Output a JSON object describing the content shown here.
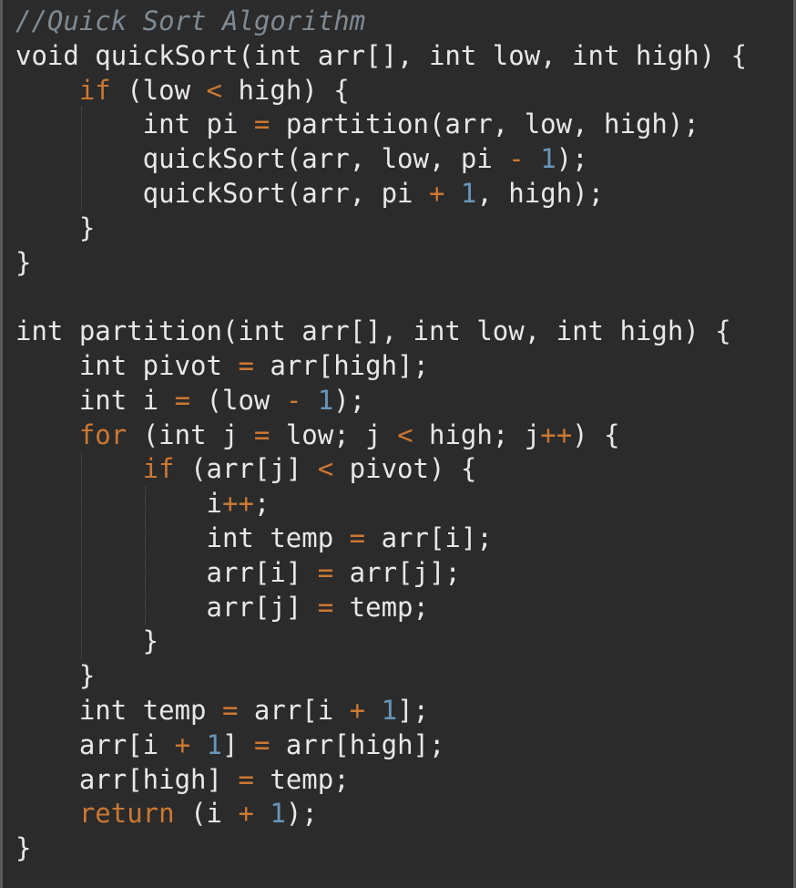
{
  "editor": {
    "language": "c",
    "theme": "dark",
    "colors": {
      "background": "#2b2b2b",
      "text": "#e8e8e8",
      "keyword": "#cc7832",
      "number": "#6897bb",
      "comment": "#7f8a93",
      "operator": "#cc7832"
    },
    "lines": [
      [
        {
          "t": "comment",
          "v": "//Quick Sort Algorithm"
        }
      ],
      [
        {
          "t": "plain",
          "v": "void quickSort(int arr[], int low, int high) {"
        }
      ],
      [
        {
          "t": "plain",
          "v": "    "
        },
        {
          "t": "keyword",
          "v": "if"
        },
        {
          "t": "plain",
          "v": " (low "
        },
        {
          "t": "op",
          "v": "<"
        },
        {
          "t": "plain",
          "v": " high) {"
        }
      ],
      [
        {
          "t": "plain",
          "v": "        int pi "
        },
        {
          "t": "op",
          "v": "="
        },
        {
          "t": "plain",
          "v": " partition(arr, low, high);"
        }
      ],
      [
        {
          "t": "plain",
          "v": "        quickSort(arr, low, pi "
        },
        {
          "t": "op",
          "v": "-"
        },
        {
          "t": "plain",
          "v": " "
        },
        {
          "t": "number",
          "v": "1"
        },
        {
          "t": "plain",
          "v": ");"
        }
      ],
      [
        {
          "t": "plain",
          "v": "        quickSort(arr, pi "
        },
        {
          "t": "op",
          "v": "+"
        },
        {
          "t": "plain",
          "v": " "
        },
        {
          "t": "number",
          "v": "1"
        },
        {
          "t": "plain",
          "v": ", high);"
        }
      ],
      [
        {
          "t": "plain",
          "v": "    }"
        }
      ],
      [
        {
          "t": "plain",
          "v": "}"
        }
      ],
      [
        {
          "t": "plain",
          "v": ""
        }
      ],
      [
        {
          "t": "plain",
          "v": "int partition(int arr[], int low, int high) {"
        }
      ],
      [
        {
          "t": "plain",
          "v": "    int pivot "
        },
        {
          "t": "op",
          "v": "="
        },
        {
          "t": "plain",
          "v": " arr[high];"
        }
      ],
      [
        {
          "t": "plain",
          "v": "    int i "
        },
        {
          "t": "op",
          "v": "="
        },
        {
          "t": "plain",
          "v": " (low "
        },
        {
          "t": "op",
          "v": "-"
        },
        {
          "t": "plain",
          "v": " "
        },
        {
          "t": "number",
          "v": "1"
        },
        {
          "t": "plain",
          "v": ");"
        }
      ],
      [
        {
          "t": "plain",
          "v": "    "
        },
        {
          "t": "keyword",
          "v": "for"
        },
        {
          "t": "plain",
          "v": " (int j "
        },
        {
          "t": "op",
          "v": "="
        },
        {
          "t": "plain",
          "v": " low; j "
        },
        {
          "t": "op",
          "v": "<"
        },
        {
          "t": "plain",
          "v": " high; j"
        },
        {
          "t": "op",
          "v": "++"
        },
        {
          "t": "plain",
          "v": ") {"
        }
      ],
      [
        {
          "t": "plain",
          "v": "        "
        },
        {
          "t": "keyword",
          "v": "if"
        },
        {
          "t": "plain",
          "v": " (arr[j] "
        },
        {
          "t": "op",
          "v": "<"
        },
        {
          "t": "plain",
          "v": " pivot) {"
        }
      ],
      [
        {
          "t": "plain",
          "v": "            i"
        },
        {
          "t": "op",
          "v": "++"
        },
        {
          "t": "plain",
          "v": ";"
        }
      ],
      [
        {
          "t": "plain",
          "v": "            int temp "
        },
        {
          "t": "op",
          "v": "="
        },
        {
          "t": "plain",
          "v": " arr[i];"
        }
      ],
      [
        {
          "t": "plain",
          "v": "            arr[i] "
        },
        {
          "t": "op",
          "v": "="
        },
        {
          "t": "plain",
          "v": " arr[j];"
        }
      ],
      [
        {
          "t": "plain",
          "v": "            arr[j] "
        },
        {
          "t": "op",
          "v": "="
        },
        {
          "t": "plain",
          "v": " temp;"
        }
      ],
      [
        {
          "t": "plain",
          "v": "        }"
        }
      ],
      [
        {
          "t": "plain",
          "v": "    }"
        }
      ],
      [
        {
          "t": "plain",
          "v": "    int temp "
        },
        {
          "t": "op",
          "v": "="
        },
        {
          "t": "plain",
          "v": " arr[i "
        },
        {
          "t": "op",
          "v": "+"
        },
        {
          "t": "plain",
          "v": " "
        },
        {
          "t": "number",
          "v": "1"
        },
        {
          "t": "plain",
          "v": "];"
        }
      ],
      [
        {
          "t": "plain",
          "v": "    arr[i "
        },
        {
          "t": "op",
          "v": "+"
        },
        {
          "t": "plain",
          "v": " "
        },
        {
          "t": "number",
          "v": "1"
        },
        {
          "t": "plain",
          "v": "] "
        },
        {
          "t": "op",
          "v": "="
        },
        {
          "t": "plain",
          "v": " arr[high];"
        }
      ],
      [
        {
          "t": "plain",
          "v": "    arr[high] "
        },
        {
          "t": "op",
          "v": "="
        },
        {
          "t": "plain",
          "v": " temp;"
        }
      ],
      [
        {
          "t": "plain",
          "v": "    "
        },
        {
          "t": "keyword",
          "v": "return"
        },
        {
          "t": "plain",
          "v": " (i "
        },
        {
          "t": "op",
          "v": "+"
        },
        {
          "t": "plain",
          "v": " "
        },
        {
          "t": "number",
          "v": "1"
        },
        {
          "t": "plain",
          "v": ");"
        }
      ],
      [
        {
          "t": "plain",
          "v": "}"
        }
      ]
    ]
  }
}
